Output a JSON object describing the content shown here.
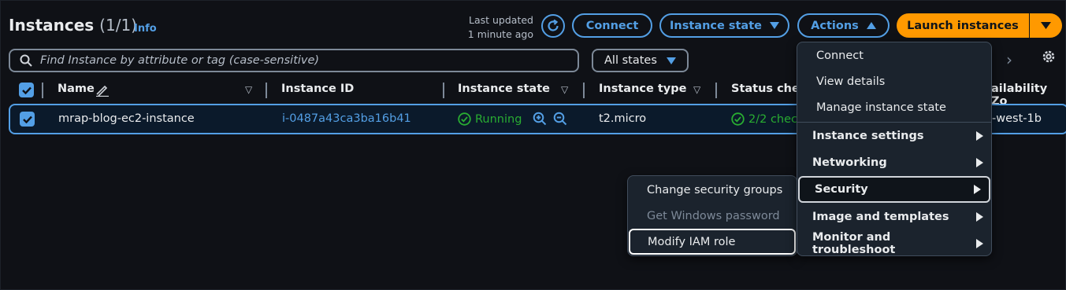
{
  "header": {
    "title": "Instances",
    "count": "(1/1)",
    "info_label": "Info",
    "last_updated_line1": "Last updated",
    "last_updated_line2": "1 minute ago"
  },
  "toolbar": {
    "connect_label": "Connect",
    "instance_state_label": "Instance state",
    "actions_label": "Actions",
    "launch_label": "Launch instances"
  },
  "filter": {
    "search_placeholder": "Find Instance by attribute or tag (case-sensitive)",
    "states_label": "All states"
  },
  "table": {
    "columns": {
      "name": "Name",
      "instance_id": "Instance ID",
      "instance_state": "Instance state",
      "instance_type": "Instance type",
      "status_check": "Status chec",
      "availability_zone": "ailability Zo"
    },
    "row": {
      "name": "mrap-blog-ec2-instance",
      "instance_id": "i-0487a43ca3ba16b41",
      "state": "Running",
      "type": "t2.micro",
      "status": "2/2 chec",
      "zone": "-west-1b"
    }
  },
  "actions_menu": {
    "items": [
      "Connect",
      "View details",
      "Manage instance state"
    ],
    "groups": [
      "Instance settings",
      "Networking",
      "Security",
      "Image and templates",
      "Monitor and troubleshoot"
    ]
  },
  "security_submenu": {
    "items": [
      "Change security groups",
      "Get Windows password",
      "Modify IAM role"
    ]
  },
  "colors": {
    "accent": "#539fe5",
    "primary": "#ff9900",
    "success": "#29ad32",
    "background": "#0f1116"
  }
}
